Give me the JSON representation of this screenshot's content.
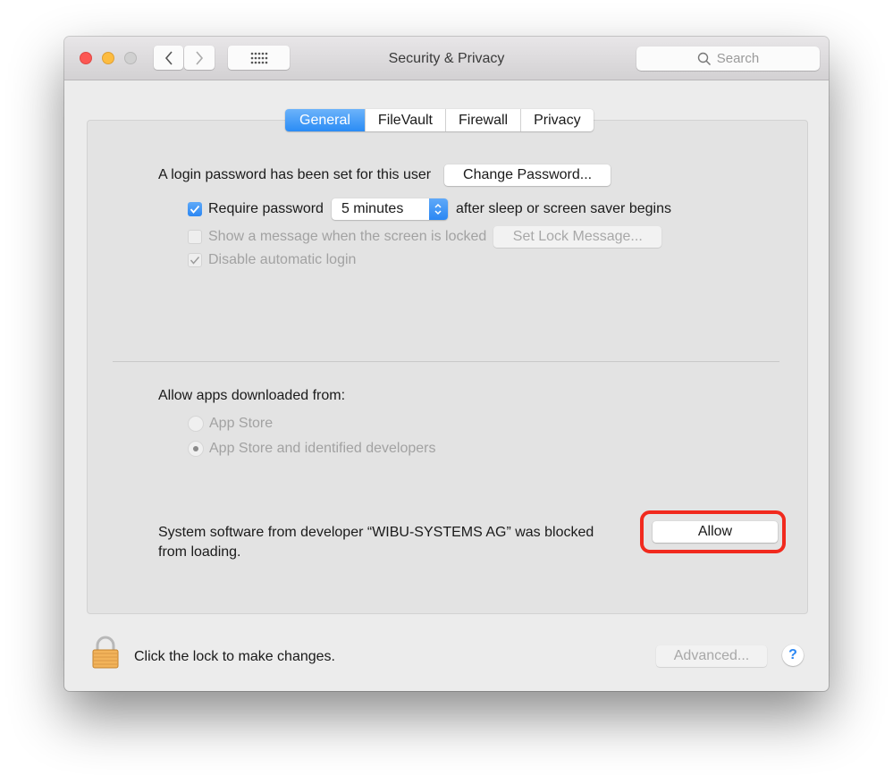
{
  "window": {
    "title": "Security & Privacy",
    "search_placeholder": "Search",
    "colors": {
      "accent": "#2b87f3",
      "highlight": "#f12a1e",
      "close": "#fc5753",
      "minimize": "#fdbc40"
    }
  },
  "tabs": [
    {
      "label": "General",
      "active": true
    },
    {
      "label": "FileVault",
      "active": false
    },
    {
      "label": "Firewall",
      "active": false
    },
    {
      "label": "Privacy",
      "active": false
    }
  ],
  "general": {
    "login_password_text": "A login password has been set for this user",
    "change_password_label": "Change Password...",
    "require_password_label": "Require password",
    "require_password_checked": true,
    "require_password_delay": "5 minutes",
    "after_sleep_text": "after sleep or screen saver begins",
    "show_message_label": "Show a message when the screen is locked",
    "show_message_checked": false,
    "set_lock_message_label": "Set Lock Message...",
    "disable_auto_login_label": "Disable automatic login",
    "disable_auto_login_checked": true
  },
  "downloads": {
    "heading": "Allow apps downloaded from:",
    "options": [
      {
        "label": "App Store",
        "selected": false
      },
      {
        "label": "App Store and identified developers",
        "selected": true
      }
    ]
  },
  "blocked": {
    "message_line1": "System software from developer “WIBU-SYSTEMS AG” was blocked",
    "message_line2": "from loading.",
    "allow_label": "Allow"
  },
  "footer": {
    "lock_text": "Click the lock to make changes.",
    "advanced_label": "Advanced...",
    "help_label": "?"
  }
}
